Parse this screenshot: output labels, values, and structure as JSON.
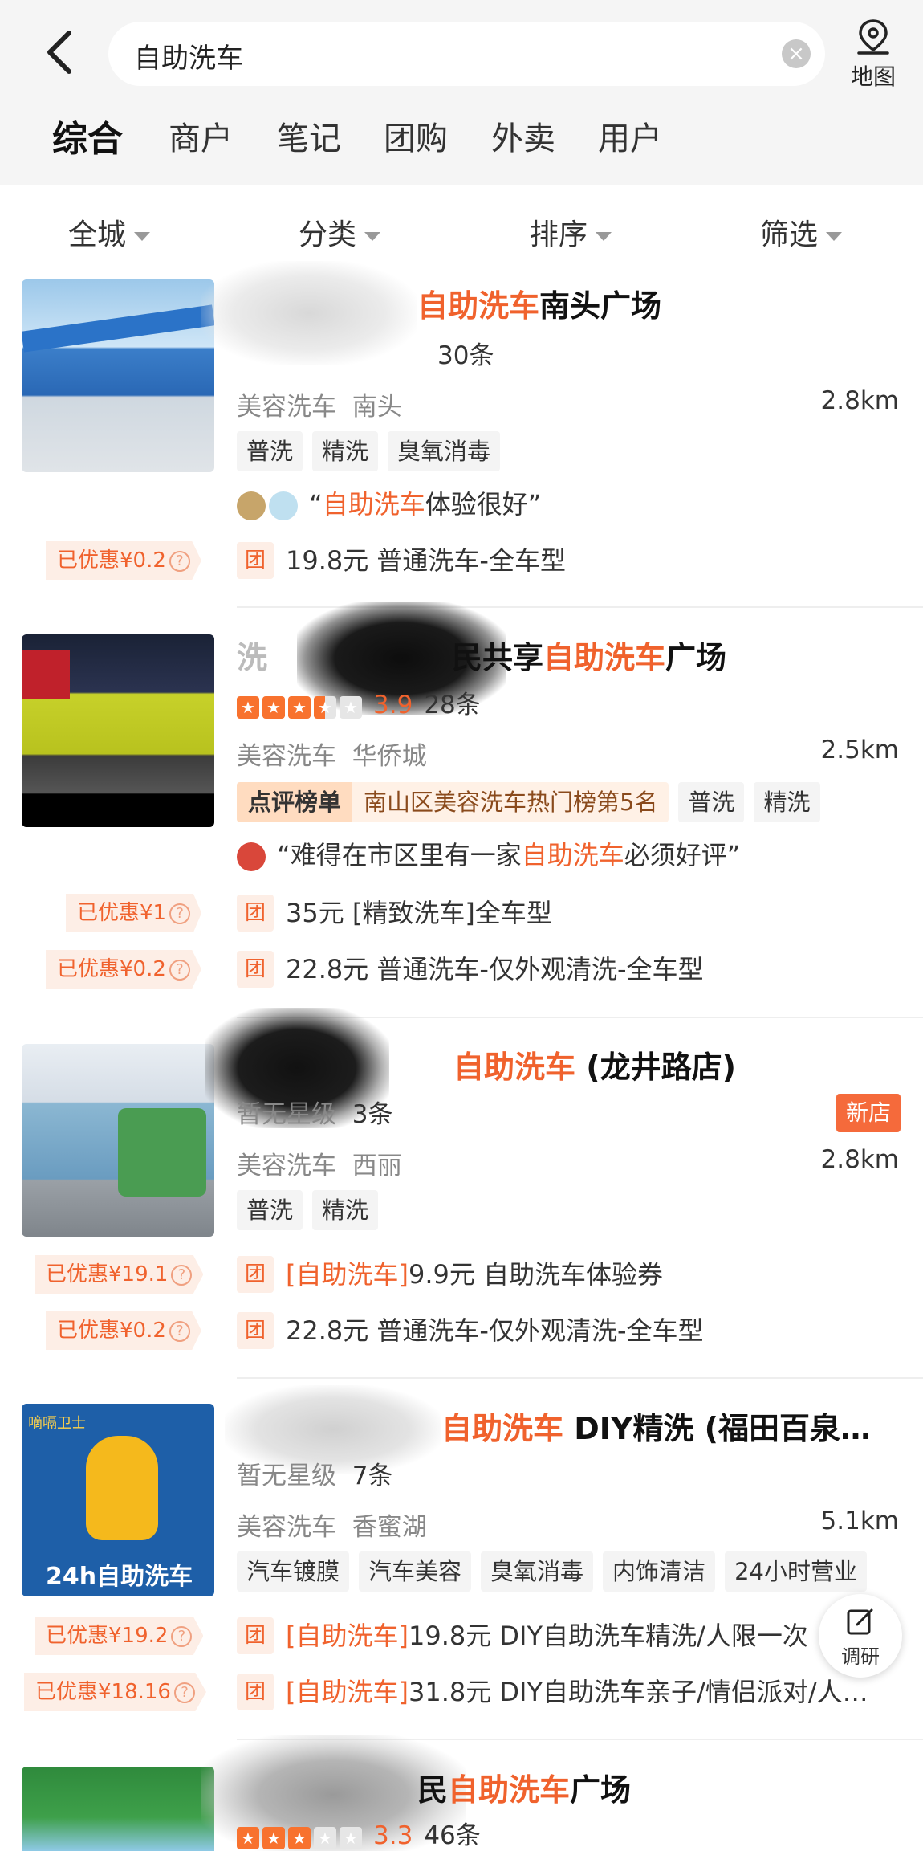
{
  "search": {
    "query": "自助洗车",
    "map_label": "地图"
  },
  "tabs": [
    "综合",
    "商户",
    "笔记",
    "团购",
    "外卖",
    "用户"
  ],
  "filters": [
    "全城",
    "分类",
    "排序",
    "筛选"
  ],
  "listings": [
    {
      "title_pre": "",
      "title_hl": "自助洗车",
      "title_post": "南头广场",
      "rating": "",
      "reviews": "30条",
      "category": "美容洗车",
      "area": "南头",
      "distance": "2.8km",
      "tags": [
        "普洗",
        "精洗",
        "臭氧消毒"
      ],
      "review_hl": "自助洗车",
      "review_post": "体验很好”",
      "review_pre": "“",
      "deals": [
        {
          "badge": "已优惠¥0.2",
          "tuan": "团",
          "text": "19.8元 普通洗车-全车型"
        }
      ]
    },
    {
      "title_pre": "洗",
      "title_mid": "民共享",
      "title_hl": "自助洗车",
      "title_post": "广场",
      "rating": "3.9",
      "reviews": "28条",
      "category": "美容洗车",
      "area": "华侨城",
      "distance": "2.5km",
      "rank_label": "点评榜单",
      "rank_text": "南山区美容洗车热门榜第5名",
      "tags": [
        "普洗",
        "精洗"
      ],
      "review_pre": "“难得在市区里有一家",
      "review_hl": "自助洗车",
      "review_post": "必须好评”",
      "deals": [
        {
          "badge": "已优惠¥1",
          "tuan": "团",
          "text": "35元 [精致洗车]全车型"
        },
        {
          "badge": "已优惠¥0.2",
          "tuan": "团",
          "text": "22.8元 普通洗车-仅外观清洗-全车型"
        }
      ]
    },
    {
      "title_hl": "自助洗车",
      "title_post": " (龙井路店)",
      "rating": "暂无星级",
      "reviews": "3条",
      "new_tag": "新店",
      "category": "美容洗车",
      "area": "西丽",
      "distance": "2.8km",
      "tags": [
        "普洗",
        "精洗"
      ],
      "deals": [
        {
          "badge": "已优惠¥19.1",
          "tuan": "团",
          "hl": "[自助洗车]",
          "text": "9.9元 自助洗车体验券"
        },
        {
          "badge": "已优惠¥0.2",
          "tuan": "团",
          "text": "22.8元 普通洗车-仅外观清洗-全车型"
        }
      ]
    },
    {
      "title_hl": "自助洗车",
      "title_post": " DIY精洗 (福田百泉…",
      "rating": "暂无星级",
      "reviews": "7条",
      "category": "美容洗车",
      "area": "香蜜湖",
      "distance": "5.1km",
      "tags": [
        "汽车镀膜",
        "汽车美容",
        "臭氧消毒",
        "内饰清洁",
        "24小时营业"
      ],
      "thumb_brand": "嘀嗝卫士",
      "thumb_text": "24h自助洗车",
      "deals": [
        {
          "badge": "已优惠¥19.2",
          "tuan": "团",
          "hl": "[自助洗车]",
          "text": "19.8元 DIY自助洗车精洗/人限一次"
        },
        {
          "badge": "已优惠¥18.16",
          "tuan": "团",
          "hl": "[自助洗车]",
          "text": "31.8元 DIY自助洗车亲子/情侣派对/人…"
        }
      ]
    },
    {
      "title_pre": "民",
      "title_hl": "自助洗车",
      "title_post": "广场",
      "rating": "3.3",
      "reviews": "46条"
    }
  ],
  "fab_label": "调研",
  "colors": {
    "accent": "#f0622d",
    "star": "#f8722e"
  }
}
